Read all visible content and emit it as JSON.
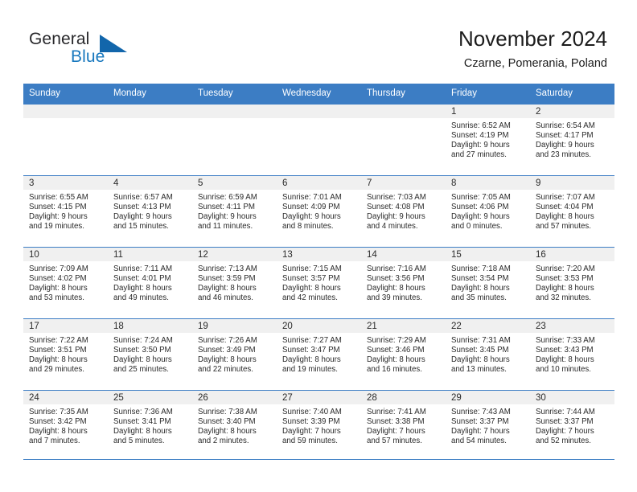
{
  "brand": {
    "name_part1": "General",
    "name_part2": "Blue",
    "logo_icon": "triangle-logo-icon",
    "accent_color": "#1266ab"
  },
  "header": {
    "title": "November 2024",
    "subtitle": "Czarne, Pomerania, Poland"
  },
  "theme": {
    "header_blue": "#3c7dc4",
    "daynum_band": "#f0f0f0",
    "text": "#2a2a2a"
  },
  "weekdays": [
    "Sunday",
    "Monday",
    "Tuesday",
    "Wednesday",
    "Thursday",
    "Friday",
    "Saturday"
  ],
  "weeks": [
    [
      {
        "empty": true
      },
      {
        "empty": true
      },
      {
        "empty": true
      },
      {
        "empty": true
      },
      {
        "empty": true
      },
      {
        "day": "1",
        "sunrise": "Sunrise: 6:52 AM",
        "sunset": "Sunset: 4:19 PM",
        "daylight1": "Daylight: 9 hours",
        "daylight2": "and 27 minutes."
      },
      {
        "day": "2",
        "sunrise": "Sunrise: 6:54 AM",
        "sunset": "Sunset: 4:17 PM",
        "daylight1": "Daylight: 9 hours",
        "daylight2": "and 23 minutes."
      }
    ],
    [
      {
        "day": "3",
        "sunrise": "Sunrise: 6:55 AM",
        "sunset": "Sunset: 4:15 PM",
        "daylight1": "Daylight: 9 hours",
        "daylight2": "and 19 minutes."
      },
      {
        "day": "4",
        "sunrise": "Sunrise: 6:57 AM",
        "sunset": "Sunset: 4:13 PM",
        "daylight1": "Daylight: 9 hours",
        "daylight2": "and 15 minutes."
      },
      {
        "day": "5",
        "sunrise": "Sunrise: 6:59 AM",
        "sunset": "Sunset: 4:11 PM",
        "daylight1": "Daylight: 9 hours",
        "daylight2": "and 11 minutes."
      },
      {
        "day": "6",
        "sunrise": "Sunrise: 7:01 AM",
        "sunset": "Sunset: 4:09 PM",
        "daylight1": "Daylight: 9 hours",
        "daylight2": "and 8 minutes."
      },
      {
        "day": "7",
        "sunrise": "Sunrise: 7:03 AM",
        "sunset": "Sunset: 4:08 PM",
        "daylight1": "Daylight: 9 hours",
        "daylight2": "and 4 minutes."
      },
      {
        "day": "8",
        "sunrise": "Sunrise: 7:05 AM",
        "sunset": "Sunset: 4:06 PM",
        "daylight1": "Daylight: 9 hours",
        "daylight2": "and 0 minutes."
      },
      {
        "day": "9",
        "sunrise": "Sunrise: 7:07 AM",
        "sunset": "Sunset: 4:04 PM",
        "daylight1": "Daylight: 8 hours",
        "daylight2": "and 57 minutes."
      }
    ],
    [
      {
        "day": "10",
        "sunrise": "Sunrise: 7:09 AM",
        "sunset": "Sunset: 4:02 PM",
        "daylight1": "Daylight: 8 hours",
        "daylight2": "and 53 minutes."
      },
      {
        "day": "11",
        "sunrise": "Sunrise: 7:11 AM",
        "sunset": "Sunset: 4:01 PM",
        "daylight1": "Daylight: 8 hours",
        "daylight2": "and 49 minutes."
      },
      {
        "day": "12",
        "sunrise": "Sunrise: 7:13 AM",
        "sunset": "Sunset: 3:59 PM",
        "daylight1": "Daylight: 8 hours",
        "daylight2": "and 46 minutes."
      },
      {
        "day": "13",
        "sunrise": "Sunrise: 7:15 AM",
        "sunset": "Sunset: 3:57 PM",
        "daylight1": "Daylight: 8 hours",
        "daylight2": "and 42 minutes."
      },
      {
        "day": "14",
        "sunrise": "Sunrise: 7:16 AM",
        "sunset": "Sunset: 3:56 PM",
        "daylight1": "Daylight: 8 hours",
        "daylight2": "and 39 minutes."
      },
      {
        "day": "15",
        "sunrise": "Sunrise: 7:18 AM",
        "sunset": "Sunset: 3:54 PM",
        "daylight1": "Daylight: 8 hours",
        "daylight2": "and 35 minutes."
      },
      {
        "day": "16",
        "sunrise": "Sunrise: 7:20 AM",
        "sunset": "Sunset: 3:53 PM",
        "daylight1": "Daylight: 8 hours",
        "daylight2": "and 32 minutes."
      }
    ],
    [
      {
        "day": "17",
        "sunrise": "Sunrise: 7:22 AM",
        "sunset": "Sunset: 3:51 PM",
        "daylight1": "Daylight: 8 hours",
        "daylight2": "and 29 minutes."
      },
      {
        "day": "18",
        "sunrise": "Sunrise: 7:24 AM",
        "sunset": "Sunset: 3:50 PM",
        "daylight1": "Daylight: 8 hours",
        "daylight2": "and 25 minutes."
      },
      {
        "day": "19",
        "sunrise": "Sunrise: 7:26 AM",
        "sunset": "Sunset: 3:49 PM",
        "daylight1": "Daylight: 8 hours",
        "daylight2": "and 22 minutes."
      },
      {
        "day": "20",
        "sunrise": "Sunrise: 7:27 AM",
        "sunset": "Sunset: 3:47 PM",
        "daylight1": "Daylight: 8 hours",
        "daylight2": "and 19 minutes."
      },
      {
        "day": "21",
        "sunrise": "Sunrise: 7:29 AM",
        "sunset": "Sunset: 3:46 PM",
        "daylight1": "Daylight: 8 hours",
        "daylight2": "and 16 minutes."
      },
      {
        "day": "22",
        "sunrise": "Sunrise: 7:31 AM",
        "sunset": "Sunset: 3:45 PM",
        "daylight1": "Daylight: 8 hours",
        "daylight2": "and 13 minutes."
      },
      {
        "day": "23",
        "sunrise": "Sunrise: 7:33 AM",
        "sunset": "Sunset: 3:43 PM",
        "daylight1": "Daylight: 8 hours",
        "daylight2": "and 10 minutes."
      }
    ],
    [
      {
        "day": "24",
        "sunrise": "Sunrise: 7:35 AM",
        "sunset": "Sunset: 3:42 PM",
        "daylight1": "Daylight: 8 hours",
        "daylight2": "and 7 minutes."
      },
      {
        "day": "25",
        "sunrise": "Sunrise: 7:36 AM",
        "sunset": "Sunset: 3:41 PM",
        "daylight1": "Daylight: 8 hours",
        "daylight2": "and 5 minutes."
      },
      {
        "day": "26",
        "sunrise": "Sunrise: 7:38 AM",
        "sunset": "Sunset: 3:40 PM",
        "daylight1": "Daylight: 8 hours",
        "daylight2": "and 2 minutes."
      },
      {
        "day": "27",
        "sunrise": "Sunrise: 7:40 AM",
        "sunset": "Sunset: 3:39 PM",
        "daylight1": "Daylight: 7 hours",
        "daylight2": "and 59 minutes."
      },
      {
        "day": "28",
        "sunrise": "Sunrise: 7:41 AM",
        "sunset": "Sunset: 3:38 PM",
        "daylight1": "Daylight: 7 hours",
        "daylight2": "and 57 minutes."
      },
      {
        "day": "29",
        "sunrise": "Sunrise: 7:43 AM",
        "sunset": "Sunset: 3:37 PM",
        "daylight1": "Daylight: 7 hours",
        "daylight2": "and 54 minutes."
      },
      {
        "day": "30",
        "sunrise": "Sunrise: 7:44 AM",
        "sunset": "Sunset: 3:37 PM",
        "daylight1": "Daylight: 7 hours",
        "daylight2": "and 52 minutes."
      }
    ]
  ]
}
